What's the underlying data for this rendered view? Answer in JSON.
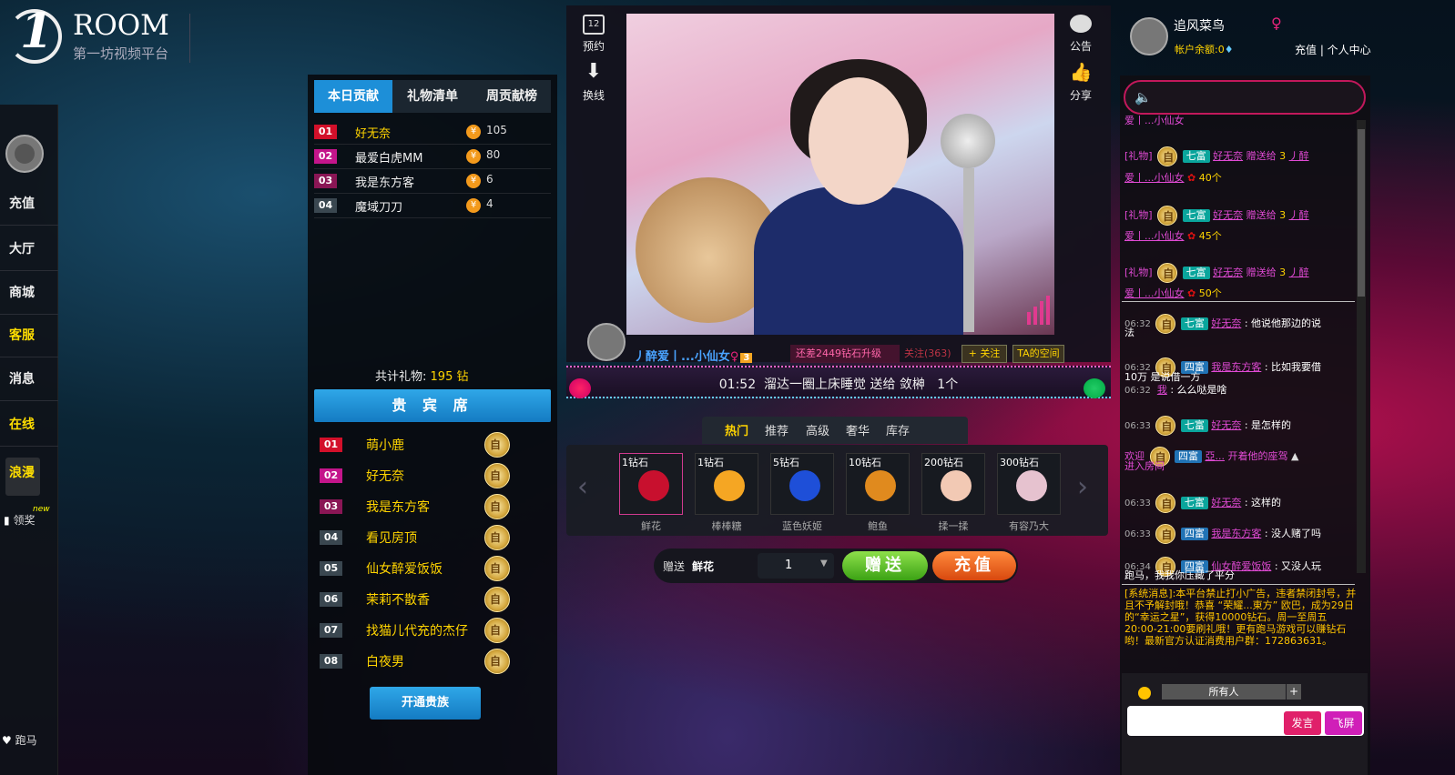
{
  "logo": {
    "mark": "1",
    "room": "ROOM",
    "subtitle": "第一坊视频平台"
  },
  "leftnav": {
    "items": [
      {
        "label": "充值",
        "yellow": false
      },
      {
        "label": "大厅",
        "yellow": false
      },
      {
        "label": "商城",
        "yellow": false
      },
      {
        "label": "客服",
        "yellow": true
      },
      {
        "label": "消息",
        "yellow": false
      },
      {
        "label": "在线",
        "yellow": true
      }
    ],
    "langman": "浪漫",
    "lingjiang": "领奖",
    "new_badge": "new",
    "paoma": "跑马"
  },
  "contrib": {
    "tabs": [
      "本日贡献",
      "礼物清单",
      "周贡献榜"
    ],
    "rows": [
      {
        "rank": "01",
        "name": "好无奈",
        "value": "105"
      },
      {
        "rank": "02",
        "name": "最爱白虎MM",
        "value": "80"
      },
      {
        "rank": "03",
        "name": "我是东方客",
        "value": "6"
      },
      {
        "rank": "04",
        "name": "魔域刀刀",
        "value": "4"
      }
    ],
    "currency_icon": "¥",
    "total_label": "共计礼物:",
    "total_value": "195 钻"
  },
  "vip": {
    "title": "贵 宾 席",
    "rows": [
      {
        "rank": "01",
        "name": "萌小鹿"
      },
      {
        "rank": "02",
        "name": "好无奈"
      },
      {
        "rank": "03",
        "name": "我是东方客"
      },
      {
        "rank": "04",
        "name": "看见房顶"
      },
      {
        "rank": "05",
        "name": "仙女醉爱饭饭"
      },
      {
        "rank": "06",
        "name": "茉莉不散香"
      },
      {
        "rank": "07",
        "name": "找猫儿代充的杰仔"
      },
      {
        "rank": "08",
        "name": "白夜男"
      }
    ],
    "open_button": "开通贵族"
  },
  "video": {
    "left_controls": [
      {
        "label": "预约",
        "icon": "calendar-icon",
        "num": "12"
      },
      {
        "label": "换线",
        "icon": "download-arrow-icon"
      }
    ],
    "right_controls": [
      {
        "label": "公告",
        "icon": "speech-bubble-icon"
      },
      {
        "label": "分享",
        "icon": "thumbs-up-icon"
      }
    ]
  },
  "host": {
    "name": "丿醉爱丨...小仙女",
    "gender": "♀",
    "level": "3",
    "upgrade": "还差2449钻石升级",
    "follow_label": "关注",
    "follow_count": "(363)",
    "follow_button": "+ 关注",
    "space_button": "TA的空间"
  },
  "marquee": {
    "time": "01:52",
    "text": "溜达一圈上床睡觉 送给 敛榊",
    "count": "1个"
  },
  "gifts": {
    "tabs": [
      "热门",
      "推荐",
      "高级",
      "奢华",
      "库存"
    ],
    "items": [
      {
        "price": "1钻石",
        "name": "鲜花",
        "color": "#c8102e"
      },
      {
        "price": "1钻石",
        "name": "棒棒糖",
        "color": "#f5a623"
      },
      {
        "price": "5钻石",
        "name": "蓝色妖姬",
        "color": "#1e4fd8"
      },
      {
        "price": "10钻石",
        "name": "鲍鱼",
        "color": "#e08a1e"
      },
      {
        "price": "200钻石",
        "name": "揉一揉",
        "color": "#f2c9b4"
      },
      {
        "price": "300钻石",
        "name": "有容乃大",
        "color": "#e6c2cf"
      }
    ]
  },
  "send": {
    "label": "赠送",
    "gift": "鲜花",
    "qty": "1",
    "send_button": "赠送",
    "charge_button": "充值"
  },
  "user": {
    "name": "追风菜鸟",
    "gender": "♀",
    "balance_label": "帐户余额:0",
    "diamond": "♦",
    "links": "充值 | 个人中心"
  },
  "chat": {
    "messages": [
      {
        "type": "gift",
        "top_line": "爱丨...小仙女",
        "prefix": "[礼物]",
        "level": "七富",
        "user": "好无奈",
        "verb": "赠送给",
        "star": "3",
        "target": "丿醉",
        "cont": "爱丨...小仙女",
        "count": "40个"
      },
      {
        "type": "gift",
        "prefix": "[礼物]",
        "level": "七富",
        "user": "好无奈",
        "verb": "赠送给",
        "star": "3",
        "target": "丿醉",
        "cont": "爱丨...小仙女",
        "count": "45个"
      },
      {
        "type": "gift",
        "prefix": "[礼物]",
        "level": "七富",
        "user": "好无奈",
        "verb": "赠送给",
        "star": "3",
        "target": "丿醉",
        "cont": "爱丨...小仙女",
        "count": "50个"
      }
    ],
    "text_messages": [
      {
        "time": "06:32",
        "level": "七富",
        "user": "好无奈",
        "text": "他说他那边的说",
        "cont": "法"
      },
      {
        "time": "06:32",
        "level": "四富",
        "user": "我是东方客",
        "text": "比如我要借",
        "cont": "10万 是说借一方"
      },
      {
        "time": "06:32",
        "user": "我",
        "text": "么么哒是啥"
      },
      {
        "time": "06:33",
        "level": "七富",
        "user": "好无奈",
        "text": "是怎样的"
      },
      {
        "welcome": "欢迎",
        "level": "四富",
        "user": "亞...",
        "text": "开着他的座驾",
        "cont": "进入房间"
      },
      {
        "time": "06:33",
        "level": "七富",
        "user": "好无奈",
        "text": "这样的"
      },
      {
        "time": "06:33",
        "level": "四富",
        "user": "我是东方客",
        "text": "没人赌了吗"
      },
      {
        "time": "06:34",
        "level": "四富",
        "user": "仙女醉爱饭饭",
        "text": "又没人玩",
        "cont": "跑马，我我你压藏了平分"
      }
    ],
    "system": "[系统消息]:本平台禁止打小广告，违者禁闭封号，并且不予解封哦！恭喜 “荣耀...東方” 欧巴，成为29日的“幸运之星”，获得10000钻石。周一至周五20:00-21:00要刷礼哦！更有跑马游戏可以赚钻石哟！最新官方认证消费用户群：172863631。",
    "to": "所有人",
    "to_plus": "+",
    "speak": "发言",
    "fly": "飞屏"
  }
}
